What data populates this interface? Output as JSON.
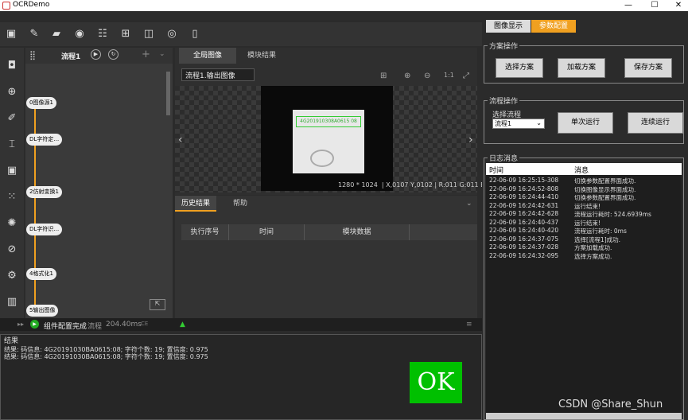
{
  "window": {
    "title": "OCRDemo"
  },
  "flow": {
    "name": "流程1",
    "nodes": [
      "0图像源1",
      "DL字符定…",
      "2仿射变换1",
      "DL字符识…",
      "4格式化1",
      "5输出图像"
    ]
  },
  "image_tabs": [
    "全局图像",
    "模块结果"
  ],
  "image_select": "流程1.输出图像",
  "image_label": "4G201910308A0615 08",
  "image_info": {
    "size": "1280 * 1024",
    "coords": "X,0107 Y,0102",
    "rgb": "R:011 G:011 B:011"
  },
  "history": {
    "tabs": [
      "历史结果",
      "帮助"
    ],
    "columns": [
      "执行序号",
      "时间",
      "模块数据"
    ]
  },
  "status": {
    "text": "组件配置完成",
    "flow": "流程",
    "time": "204.40ms",
    "ce": "CE"
  },
  "results": {
    "title": "结果",
    "lines": [
      "结果: 码信息: 4G20191030BA0615:08;  字符个数: 19;  置信度: 0.975",
      "结果: 码信息: 4G20191030BA0615:08;  字符个数: 19;  置信度: 0.975"
    ],
    "ok": "OK"
  },
  "right": {
    "tabs": [
      "图像显示",
      "参数配置"
    ],
    "scheme": {
      "title": "方案操作",
      "buttons": [
        "选择方案",
        "加载方案",
        "保存方案"
      ]
    },
    "process": {
      "title": "流程操作",
      "select_label": "选择流程",
      "select_value": "流程1",
      "buttons": [
        "单次运行",
        "连续运行"
      ]
    },
    "log": {
      "title": "日志消息",
      "columns": [
        "时间",
        "消息"
      ],
      "rows": [
        [
          "22-06-09 16:25:15-308",
          "切换参数配置界面成功."
        ],
        [
          "22-06-09 16:24:52-808",
          "切换图像显示界面成功."
        ],
        [
          "22-06-09 16:24:44-410",
          "切换参数配置界面成功."
        ],
        [
          "22-06-09 16:24:42-631",
          "运行结束!"
        ],
        [
          "22-06-09 16:24:42-628",
          "流程运行耗时: 524.6939ms"
        ],
        [
          "22-06-09 16:24:40-437",
          "运行结束!"
        ],
        [
          "22-06-09 16:24:40-420",
          "流程运行耗时: 0ms"
        ],
        [
          "22-06-09 16:24:37-075",
          "选择[流程1]成功."
        ],
        [
          "22-06-09 16:24:37-028",
          "方案加载成功."
        ],
        [
          "22-06-09 16:24:32-095",
          "选择方案成功."
        ]
      ]
    }
  },
  "watermark": "CSDN @Share_Shun",
  "colors": {
    "accent": "#f0a020",
    "ok_bg": "#00c000"
  }
}
